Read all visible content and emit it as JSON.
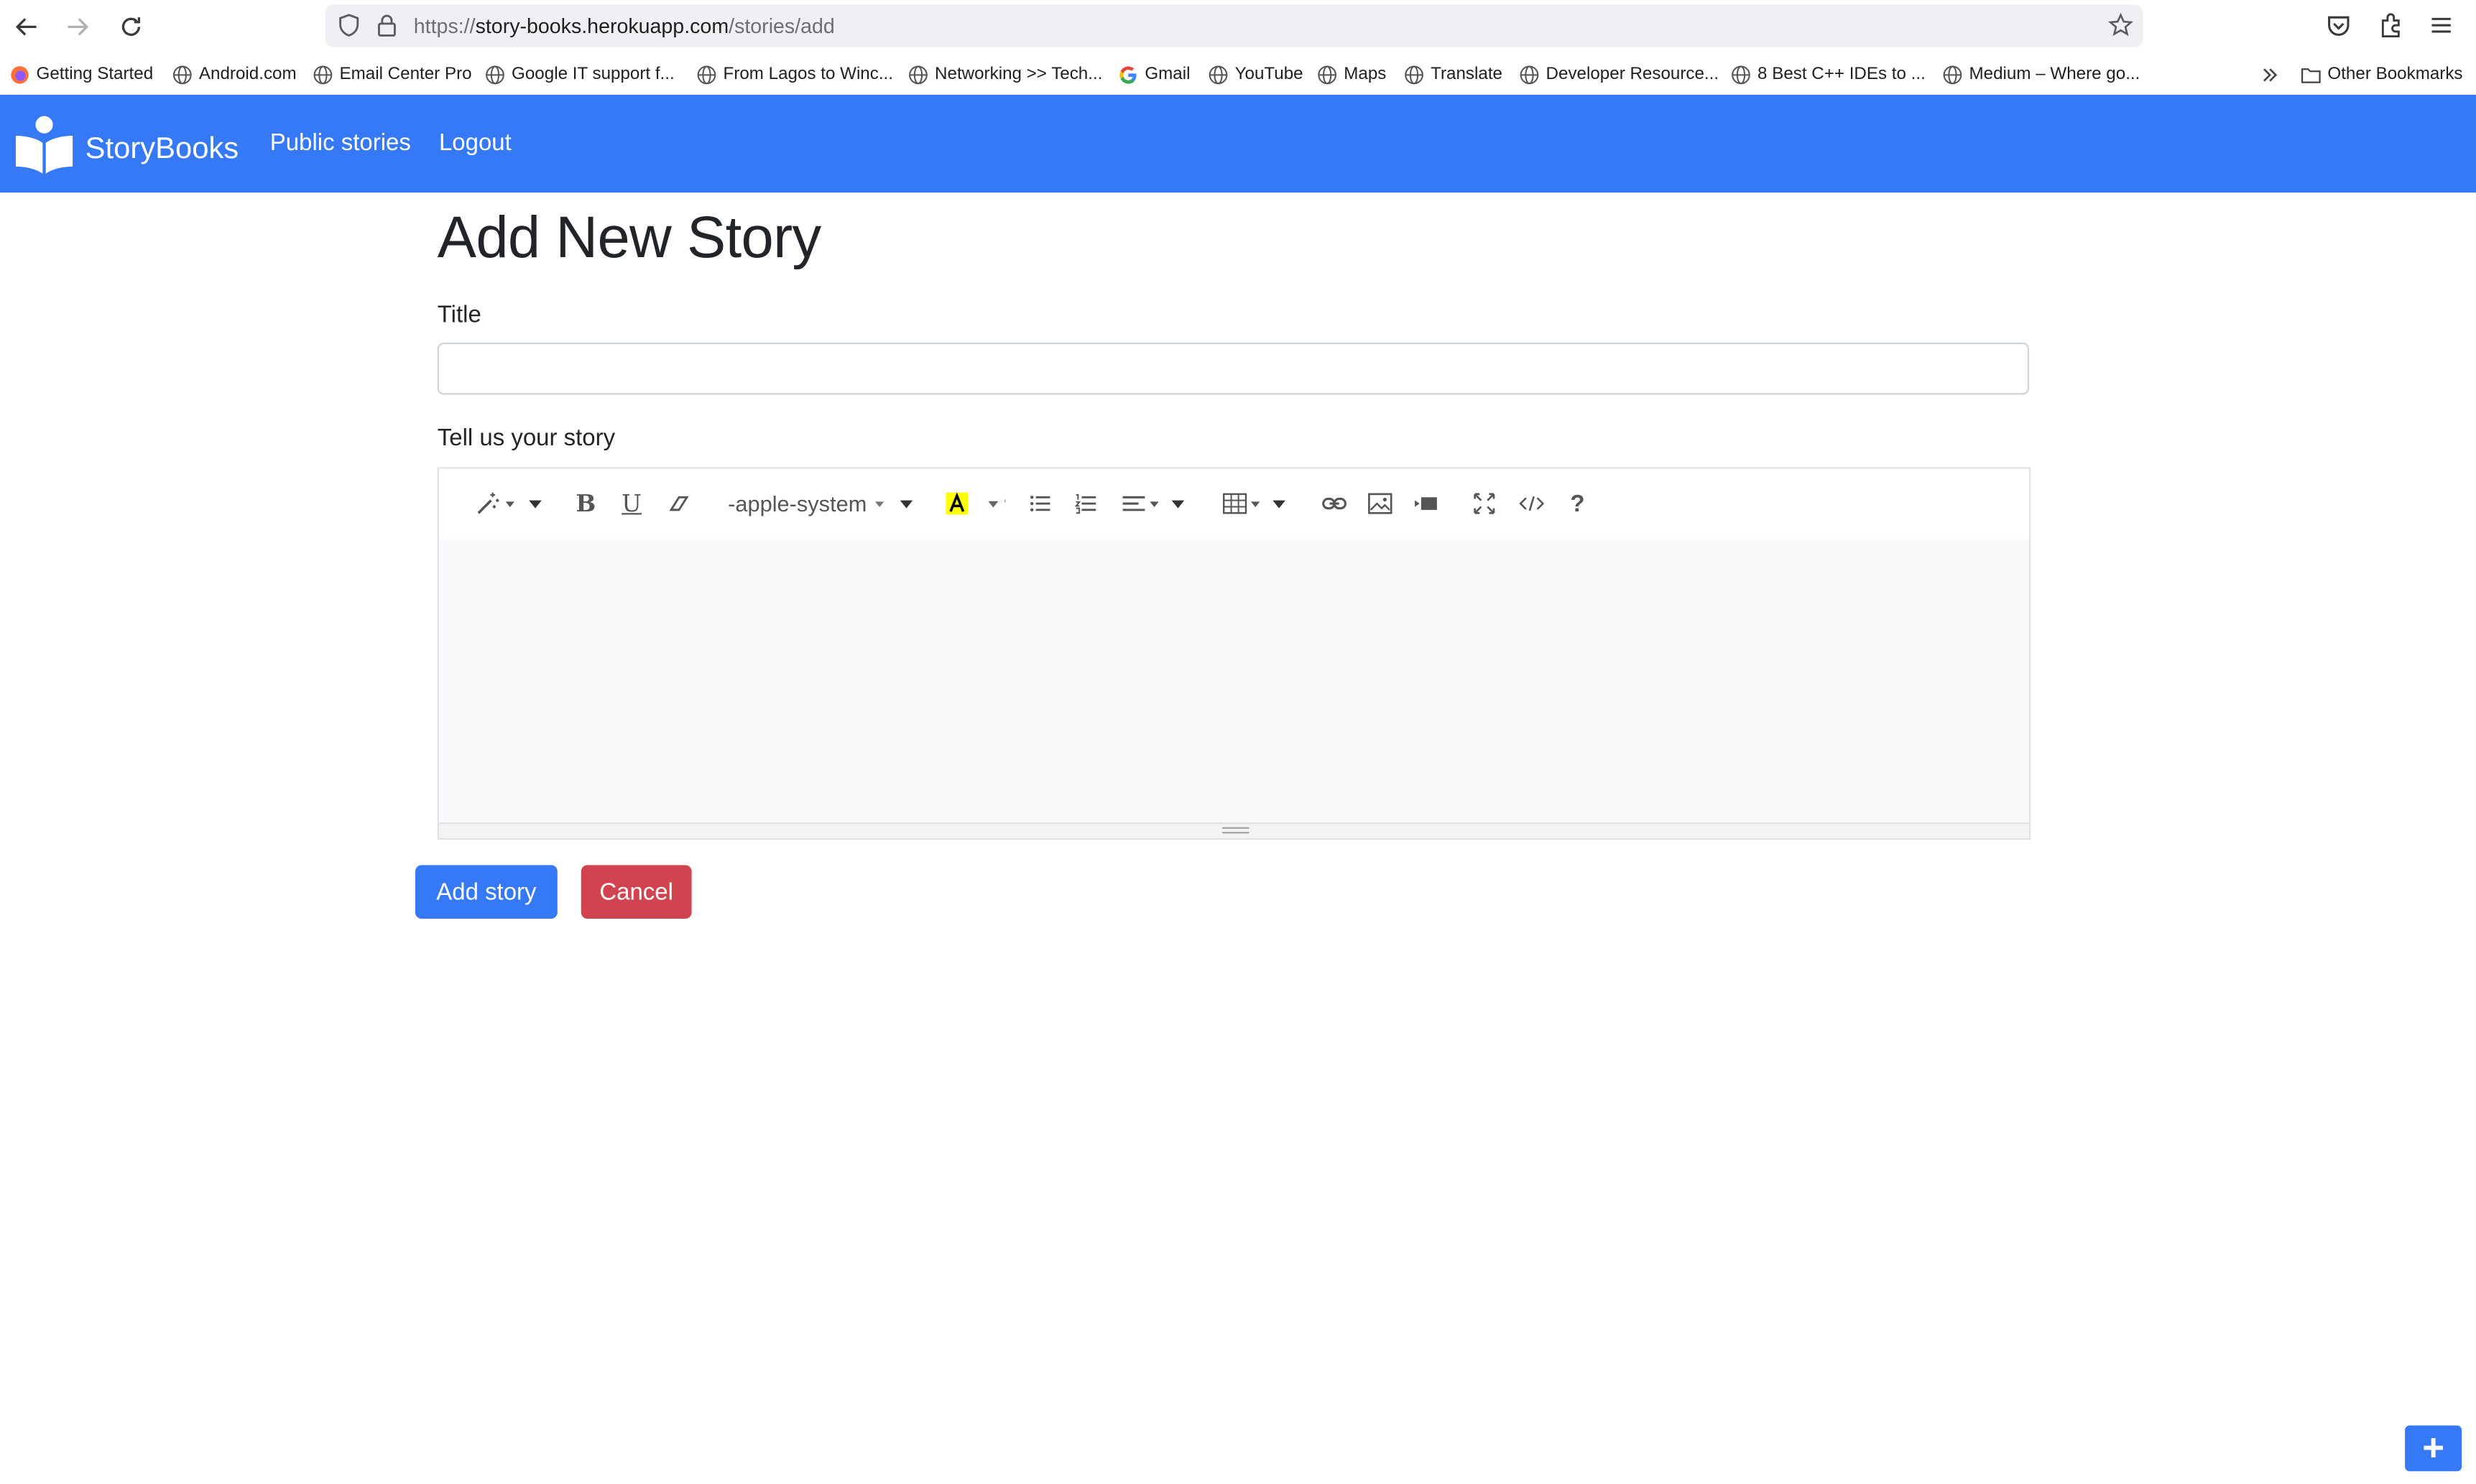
{
  "browser": {
    "url_prefix": "https://",
    "url_host": "story-books.herokuapp.com",
    "url_path": "/stories/add",
    "bookmarks": [
      {
        "label": "Getting Started",
        "icon": "firefox-icon"
      },
      {
        "label": "Android.com",
        "icon": "globe-icon"
      },
      {
        "label": "Email Center Pro",
        "icon": "globe-icon"
      },
      {
        "label": "Google IT support f...",
        "icon": "globe-icon"
      },
      {
        "label": "From Lagos to Winc...",
        "icon": "globe-icon"
      },
      {
        "label": "Networking >> Tech...",
        "icon": "globe-icon"
      },
      {
        "label": "Gmail",
        "icon": "google-icon"
      },
      {
        "label": "YouTube",
        "icon": "globe-icon"
      },
      {
        "label": "Maps",
        "icon": "globe-icon"
      },
      {
        "label": "Translate",
        "icon": "globe-icon"
      },
      {
        "label": "Developer Resource...",
        "icon": "globe-icon"
      },
      {
        "label": "8 Best C++ IDEs to ...",
        "icon": "globe-icon"
      },
      {
        "label": "Medium – Where go...",
        "icon": "globe-icon"
      }
    ],
    "other_bookmarks": "Other Bookmarks"
  },
  "nav": {
    "brand": "StoryBooks",
    "links": [
      "Public stories",
      "Logout"
    ]
  },
  "page": {
    "heading": "Add New Story",
    "title_label": "Title",
    "title_value": "",
    "story_label": "Tell us your story",
    "font_name": "-apple-system",
    "add_button": "Add story",
    "cancel_button": "Cancel",
    "fab_label": "+"
  },
  "colors": {
    "primary": "#3579f6",
    "danger": "#d0434f"
  }
}
